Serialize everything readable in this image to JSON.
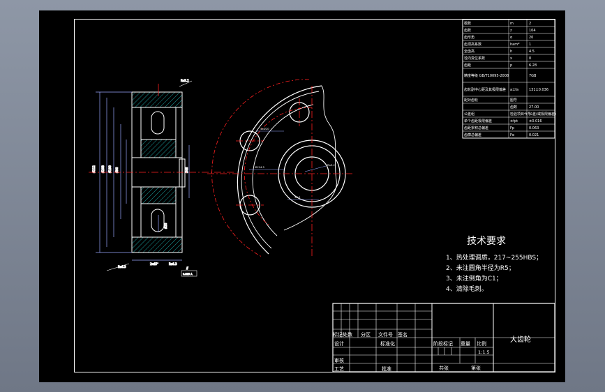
{
  "param_table": [
    {
      "name": "模数",
      "symbol": "m",
      "value": "2"
    },
    {
      "name": "齿数",
      "symbol": "z",
      "value": "104"
    },
    {
      "name": "齿形角",
      "symbol": "α",
      "value": "20"
    },
    {
      "name": "齿顶高系数",
      "symbol": "ham*",
      "value": "1"
    },
    {
      "name": "全齿高",
      "symbol": "h",
      "value": "4.5"
    },
    {
      "name": "径向变位系数",
      "symbol": "x",
      "value": "0"
    },
    {
      "name": "齿距",
      "symbol": "p",
      "value": "6.28"
    },
    {
      "name": "精度等级 GB/T10095-2008",
      "symbol": "",
      "value": "7GB"
    },
    {
      "name": "齿轮副中心距及其极限偏差",
      "symbol": "a±fa",
      "value": "131±0.036"
    },
    {
      "name": "配对齿轮",
      "symbol": "图号",
      "value": ""
    },
    {
      "name": "",
      "symbol": "齿数",
      "value": "27.00"
    },
    {
      "name": "公差组",
      "symbol": "检验项目代号",
      "value": "公差(或极限偏差)值"
    },
    {
      "name": "单个齿距极限偏差",
      "symbol": "±fpt",
      "value": "±0.016"
    },
    {
      "name": "齿距累积总偏差",
      "symbol": "Fp",
      "value": "0.063"
    },
    {
      "name": "齿廓总偏差",
      "symbol": "Fα",
      "value": "0.021"
    }
  ],
  "tech": {
    "title": "技术要求",
    "items": [
      "1、热处理调质，217~255HBS；",
      "2、未注圆角半径为R5；",
      "3、未注倒角为C1；",
      "4、清除毛刺。"
    ]
  },
  "title_block": {
    "part_name": "大齿轮",
    "row_labels": [
      "标记",
      "处数",
      "分区",
      "文件号",
      "签名"
    ],
    "design": "设计",
    "standardize": "标准化",
    "review": "审核",
    "process": "工艺",
    "approve": "批准",
    "stage_mark": "阶段标记",
    "weight": "重量",
    "scale": "比例",
    "scale_value": "1:1.5",
    "sheets_total": "共张",
    "sheet_no": "第张"
  },
  "colors": {
    "line": "#ffffff",
    "center": "#ff2020",
    "dim": "#9aa8ff",
    "hatch": "#20c8c8"
  }
}
